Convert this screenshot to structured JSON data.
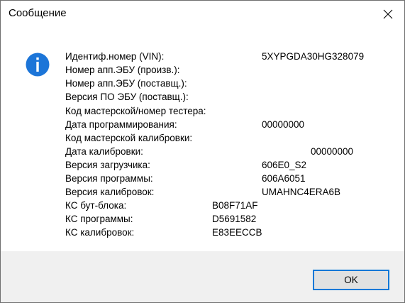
{
  "window": {
    "title": "Сообщение"
  },
  "icons": {
    "info": "info-icon",
    "close": "close-icon",
    "accent_color": "#1c75d8"
  },
  "rows": [
    {
      "label": "Идентиф.номер (VIN):",
      "value": "5XYPGDA30HG328079"
    },
    {
      "label": "Номер апп.ЭБУ (произв.):",
      "value": ""
    },
    {
      "label": "Номер апп.ЭБУ (поставщ.):",
      "value": ""
    },
    {
      "label": "Версия ПО ЭБУ (поставщ.):",
      "value": ""
    },
    {
      "label": "Код мастерской/номер тестера:",
      "value": ""
    },
    {
      "label": "Дата программирования:",
      "value": "00000000"
    },
    {
      "label": "Код мастерской калибровки:",
      "value": ""
    },
    {
      "label": "Дата калибровки:",
      "value": "00000000"
    },
    {
      "label": "Версия загрузчика:",
      "value": "606E0_S2"
    },
    {
      "label": "Версия программы:",
      "value": "606A6051"
    },
    {
      "label": "Версия калибровок:",
      "value": "UMAHNC4ERA6B"
    },
    {
      "label": "КС бут-блока:",
      "value": "B08F71AF"
    },
    {
      "label": "КС программы:",
      "value": "D5691582"
    },
    {
      "label": "КС калибровок:",
      "value": "E83EECCB"
    }
  ],
  "buttons": {
    "ok_label": "OK"
  }
}
